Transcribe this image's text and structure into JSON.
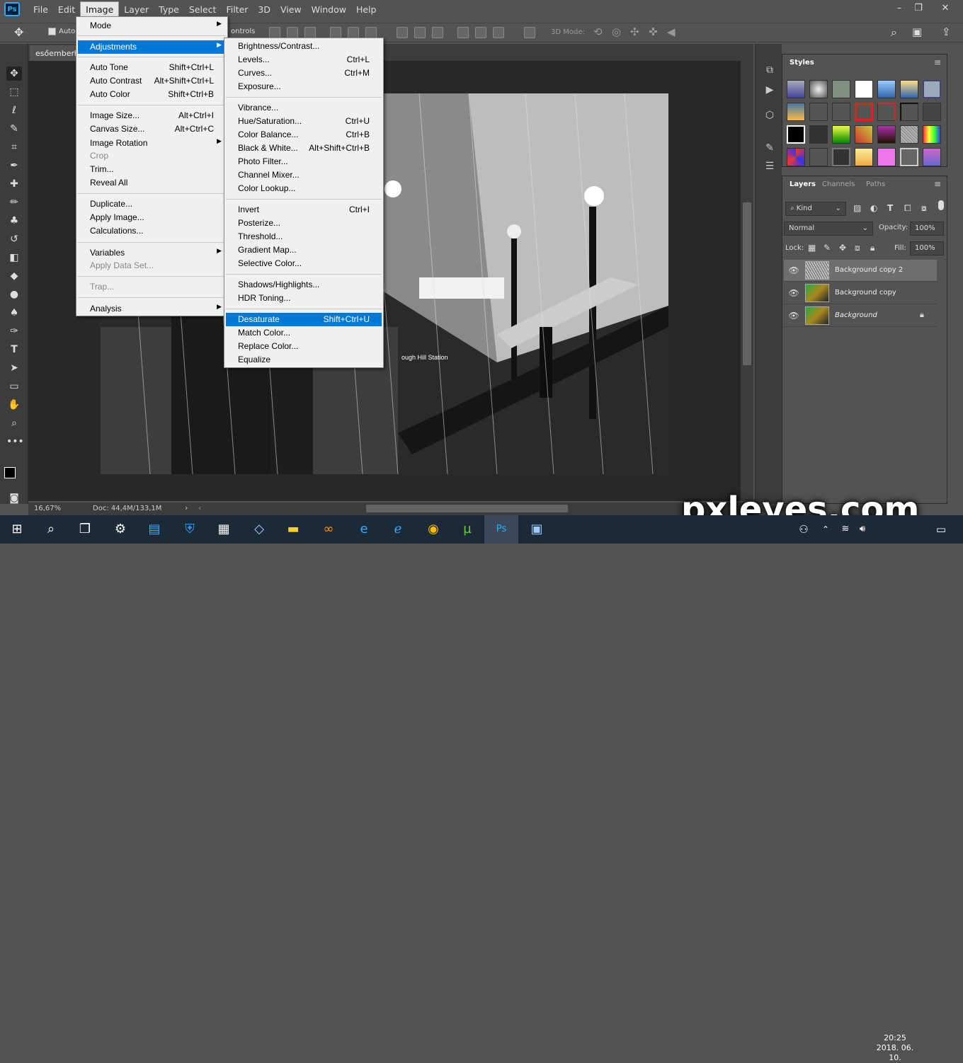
{
  "app": {
    "logo": "Ps"
  },
  "menubar": [
    "File",
    "Edit",
    "Image",
    "Layer",
    "Type",
    "Select",
    "Filter",
    "3D",
    "View",
    "Window",
    "Help"
  ],
  "optbar": {
    "auto_label": "Auto-",
    "controls_label": "ontrols",
    "mode3d_label": "3D Mode:"
  },
  "document": {
    "tab_title": "esőemberh",
    "zoom": "16,67%",
    "doc_info": "Doc: 44,4M/133,1M"
  },
  "image_menu": [
    {
      "label": "Mode",
      "shortcut": "",
      "submenu": true,
      "disabled": false
    },
    {
      "label": "Adjustments",
      "shortcut": "",
      "submenu": true,
      "disabled": false,
      "highlight": true
    },
    {
      "label": "Auto Tone",
      "shortcut": "Shift+Ctrl+L"
    },
    {
      "label": "Auto Contrast",
      "shortcut": "Alt+Shift+Ctrl+L"
    },
    {
      "label": "Auto Color",
      "shortcut": "Shift+Ctrl+B"
    },
    {
      "label": "Image Size...",
      "shortcut": "Alt+Ctrl+I"
    },
    {
      "label": "Canvas Size...",
      "shortcut": "Alt+Ctrl+C"
    },
    {
      "label": "Image Rotation",
      "shortcut": "",
      "submenu": true
    },
    {
      "label": "Crop",
      "shortcut": "",
      "disabled": true
    },
    {
      "label": "Trim...",
      "shortcut": ""
    },
    {
      "label": "Reveal All",
      "shortcut": ""
    },
    {
      "label": "Duplicate...",
      "shortcut": ""
    },
    {
      "label": "Apply Image...",
      "shortcut": ""
    },
    {
      "label": "Calculations...",
      "shortcut": ""
    },
    {
      "label": "Variables",
      "shortcut": "",
      "submenu": true
    },
    {
      "label": "Apply Data Set...",
      "shortcut": "",
      "disabled": true
    },
    {
      "label": "Trap...",
      "shortcut": "",
      "disabled": true
    },
    {
      "label": "Analysis",
      "shortcut": "",
      "submenu": true
    }
  ],
  "adjustments_menu": [
    {
      "label": "Brightness/Contrast...",
      "shortcut": ""
    },
    {
      "label": "Levels...",
      "shortcut": "Ctrl+L"
    },
    {
      "label": "Curves...",
      "shortcut": "Ctrl+M"
    },
    {
      "label": "Exposure...",
      "shortcut": ""
    },
    {
      "label": "Vibrance...",
      "shortcut": ""
    },
    {
      "label": "Hue/Saturation...",
      "shortcut": "Ctrl+U"
    },
    {
      "label": "Color Balance...",
      "shortcut": "Ctrl+B"
    },
    {
      "label": "Black & White...",
      "shortcut": "Alt+Shift+Ctrl+B"
    },
    {
      "label": "Photo Filter...",
      "shortcut": ""
    },
    {
      "label": "Channel Mixer...",
      "shortcut": ""
    },
    {
      "label": "Color Lookup...",
      "shortcut": ""
    },
    {
      "label": "Invert",
      "shortcut": "Ctrl+I"
    },
    {
      "label": "Posterize...",
      "shortcut": ""
    },
    {
      "label": "Threshold...",
      "shortcut": ""
    },
    {
      "label": "Gradient Map...",
      "shortcut": ""
    },
    {
      "label": "Selective Color...",
      "shortcut": ""
    },
    {
      "label": "Shadows/Highlights...",
      "shortcut": ""
    },
    {
      "label": "HDR Toning...",
      "shortcut": ""
    },
    {
      "label": "Desaturate",
      "shortcut": "Shift+Ctrl+U",
      "highlight": true
    },
    {
      "label": "Match Color...",
      "shortcut": ""
    },
    {
      "label": "Replace Color...",
      "shortcut": ""
    },
    {
      "label": "Equalize",
      "shortcut": ""
    }
  ],
  "styles_panel": {
    "title": "Styles"
  },
  "layers_panel": {
    "tabs": [
      "Layers",
      "Channels",
      "Paths"
    ],
    "kind": "Kind",
    "blend_mode": "Normal",
    "opacity_label": "Opacity:",
    "opacity": "100%",
    "lock_label": "Lock:",
    "fill_label": "Fill:",
    "fill": "100%",
    "layers": [
      {
        "name": "Background copy 2",
        "selected": true
      },
      {
        "name": "Background copy",
        "selected": false
      },
      {
        "name": "Background",
        "selected": false,
        "locked": true
      }
    ]
  },
  "taskbar": {
    "clock_time": "20:25",
    "clock_date": "2018. 06. 10."
  },
  "watermark": "pxleyes.com",
  "image_text": "ough Hill Station"
}
